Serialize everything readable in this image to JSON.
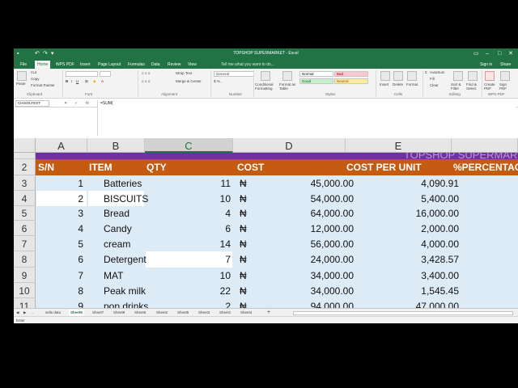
{
  "window": {
    "title": "TOPSHOP SUPERMARKET - Excel",
    "sign_in": "Sign in",
    "share": "Share"
  },
  "menu": {
    "tabs": [
      "File",
      "Home",
      "WPS PDF",
      "Insert",
      "Page Layout",
      "Formulas",
      "Data",
      "Review",
      "View"
    ],
    "active": "Home",
    "tell_me": "Tell me what you want to do..."
  },
  "ribbon": {
    "paste": "Paste",
    "cut": "Cut",
    "copy": "Copy",
    "format_painter": "Format Painter",
    "clipboard": "Clipboard",
    "font": "Font",
    "wrap_text": "Wrap Text",
    "merge_center": "Merge & Center",
    "alignment": "Alignment",
    "number_format": "General",
    "number": "Number",
    "conditional_formatting": "Conditional Formatting",
    "format_as_table": "Format as Table",
    "styles": {
      "normal": "Normal",
      "bad": "Bad",
      "good": "Good",
      "neutral": "Neutral",
      "label": "Styles"
    },
    "insert": "Insert",
    "delete": "Delete",
    "format": "Format",
    "cells": "Cells",
    "autosum": "AutoSum",
    "fill": "Fill",
    "clear": "Clear",
    "sort_filter": "Sort & Filter",
    "find_select": "Find & Select",
    "editing": "Editing",
    "create_pdf": "Create PDF",
    "sign_pdf": "Sign PDF",
    "wps_pdf": "WPS PDF"
  },
  "formula_bar": {
    "name_box": "CHISOLTEST",
    "fx": "fx",
    "content": "=SUM("
  },
  "grid": {
    "columns": [
      "A",
      "B",
      "C",
      "D",
      "E"
    ],
    "selected_column": "C",
    "banner": "TOPSHOP SUPERMARKET",
    "header_row_number": "2",
    "headers": [
      "S/N",
      "ITEM",
      "QTY",
      "COST",
      "COST PER UNIT",
      "%PERCENTAGE"
    ],
    "currency_symbol": "₦",
    "rows": [
      {
        "row": "3",
        "sn": "1",
        "item": "Batteries",
        "qty": "11",
        "cost": "45,000.00",
        "cpu": "4,090.91"
      },
      {
        "row": "4",
        "sn": "2",
        "item": "BISCUITS",
        "qty": "10",
        "cost": "54,000.00",
        "cpu": "5,400.00"
      },
      {
        "row": "5",
        "sn": "3",
        "item": "Bread",
        "qty": "4",
        "cost": "64,000.00",
        "cpu": "16,000.00"
      },
      {
        "row": "6",
        "sn": "4",
        "item": "Candy",
        "qty": "6",
        "cost": "12,000.00",
        "cpu": "2,000.00"
      },
      {
        "row": "7",
        "sn": "5",
        "item": "cream",
        "qty": "14",
        "cost": "56,000.00",
        "cpu": "4,000.00"
      },
      {
        "row": "8",
        "sn": "6",
        "item": "Detergent",
        "qty": "7",
        "cost": "24,000.00",
        "cpu": "3,428.57"
      },
      {
        "row": "9",
        "sn": "7",
        "item": "MAT",
        "qty": "10",
        "cost": "34,000.00",
        "cpu": "3,400.00"
      },
      {
        "row": "10",
        "sn": "8",
        "item": "Peak milk",
        "qty": "22",
        "cost": "34,000.00",
        "cpu": "1,545.45"
      },
      {
        "row": "11",
        "sn": "9",
        "item": "pop drinks",
        "qty": "2",
        "cost": "94,000.00",
        "cpu": "47,000.00"
      }
    ]
  },
  "sheet_tabs": {
    "tabs": [
      "sells data",
      "Sheet9",
      "Sheet7",
      "Sheet8",
      "Sheet6",
      "Sheet2",
      "Sheet5",
      "Sheet3",
      "Sheet1",
      "Sheet4"
    ],
    "active": "Sheet9",
    "add": "+"
  },
  "status": {
    "mode": "Enter"
  },
  "colors": {
    "excel_green": "#217346",
    "header_orange": "#c55a11",
    "banner_purple": "#7030a0",
    "row_blue": "#ddebf7"
  }
}
